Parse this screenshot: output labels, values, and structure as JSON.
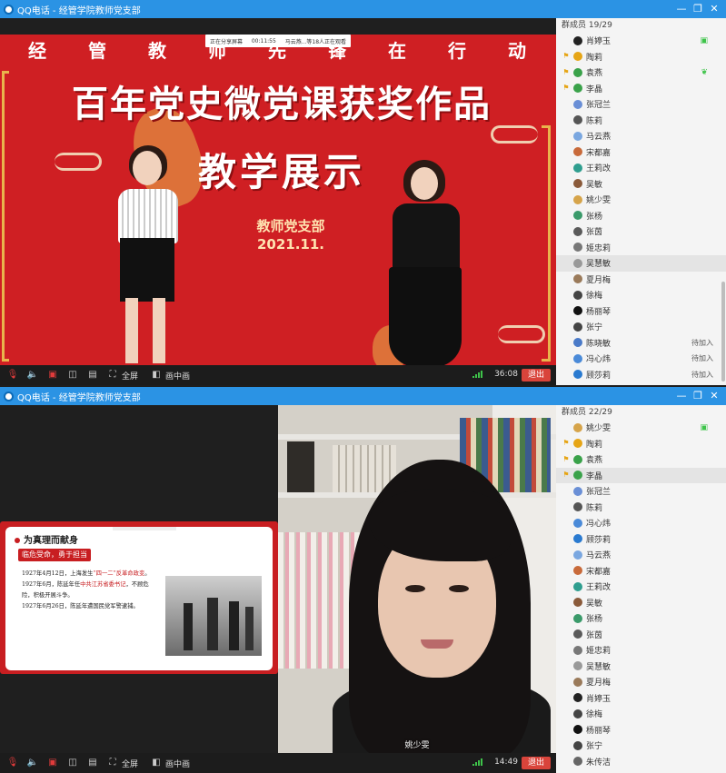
{
  "windows": [
    {
      "title": "QQ电话 - 经管学院教师党支部",
      "share_bar": {
        "sharing": "正在分享屏幕",
        "duration": "00:11:55",
        "watching": "马云燕...等18人正在观看"
      },
      "slide": {
        "top_words": [
          "经",
          "管",
          "教",
          "师",
          "先",
          "锋",
          "在",
          "行",
          "动"
        ],
        "title": "百年党史微党课获奖作品",
        "subtitle": "教学展示",
        "dept": "教师党支部",
        "date": "2021.11."
      },
      "toolbar": {
        "fullscreen": "全屏",
        "pip": "画中画",
        "timer": "36:08",
        "exit": "退出"
      },
      "member_header": "群成员 19/29",
      "members": [
        {
          "name": "肖婷玉",
          "badge": "",
          "color": "#222",
          "status": "",
          "right_icon": "screen"
        },
        {
          "name": "陶莉",
          "badge": "admin",
          "color": "#e6a516",
          "status": "",
          "right_icon": ""
        },
        {
          "name": "袁燕",
          "badge": "admin",
          "color": "#3aa24a",
          "status": "",
          "right_icon": "sound"
        },
        {
          "name": "李晶",
          "badge": "admin",
          "color": "#3aa24a",
          "status": "",
          "right_icon": ""
        },
        {
          "name": "张冠兰",
          "badge": "",
          "color": "#6a8fd6",
          "status": "",
          "right_icon": ""
        },
        {
          "name": "陈莉",
          "badge": "",
          "color": "#555",
          "status": "",
          "right_icon": ""
        },
        {
          "name": "马云燕",
          "badge": "",
          "color": "#7aa7e0",
          "status": "",
          "right_icon": ""
        },
        {
          "name": "宋都嘉",
          "badge": "",
          "color": "#c86a3a",
          "status": "",
          "right_icon": ""
        },
        {
          "name": "王莉改",
          "badge": "",
          "color": "#2f9e8f",
          "status": "",
          "right_icon": ""
        },
        {
          "name": "吴敏",
          "badge": "",
          "color": "#8a5a3a",
          "status": "",
          "right_icon": ""
        },
        {
          "name": "姚少雯",
          "badge": "",
          "color": "#d6a44a",
          "status": "",
          "right_icon": ""
        },
        {
          "name": "张杨",
          "badge": "",
          "color": "#3a9a6a",
          "status": "",
          "right_icon": ""
        },
        {
          "name": "张茵",
          "badge": "",
          "color": "#5a5a5a",
          "status": "",
          "right_icon": ""
        },
        {
          "name": "姬忠莉",
          "badge": "",
          "color": "#777",
          "status": "",
          "right_icon": ""
        },
        {
          "name": "吴慧敏",
          "badge": "",
          "color": "#999",
          "status": "",
          "right_icon": "",
          "selected": true
        },
        {
          "name": "夏月梅",
          "badge": "",
          "color": "#9a7a5a",
          "status": "",
          "right_icon": ""
        },
        {
          "name": "徐梅",
          "badge": "",
          "color": "#444",
          "status": "",
          "right_icon": ""
        },
        {
          "name": "杨丽琴",
          "badge": "",
          "color": "#111",
          "status": "",
          "right_icon": ""
        },
        {
          "name": "张宁",
          "badge": "",
          "color": "#444",
          "status": "",
          "right_icon": ""
        },
        {
          "name": "陈晓敏",
          "badge": "",
          "color": "#4a7ac8",
          "status": "待加入",
          "right_icon": ""
        },
        {
          "name": "冯心炜",
          "badge": "",
          "color": "#4a8ad8",
          "status": "待加入",
          "right_icon": ""
        },
        {
          "name": "顾莎莉",
          "badge": "",
          "color": "#2a7ad0",
          "status": "待加入",
          "right_icon": ""
        }
      ]
    },
    {
      "title": "QQ电话 - 经管学院教师党支部",
      "slide": {
        "heading": "为真理而献身",
        "tag": "临危受命，勇于担当",
        "lines": [
          {
            "pre": "1927年4月12日，上海发生",
            "hl": "“四一二”反革命政变",
            "post": "。"
          },
          {
            "pre": "1927年6月，陈延年任",
            "hl": "中共江苏省委书记",
            "post": "，不顾危"
          },
          {
            "pre": "险，积极开展斗争。",
            "hl": "",
            "post": ""
          },
          {
            "pre": "1927年6月26日，陈延年遭国民党军警逮捕。",
            "hl": "",
            "post": ""
          }
        ]
      },
      "camera_name": "姚少雯",
      "toolbar": {
        "fullscreen": "全屏",
        "pip": "画中画",
        "timer": "14:49",
        "exit": "退出"
      },
      "member_header": "群成员 22/29",
      "members": [
        {
          "name": "姚少雯",
          "badge": "",
          "color": "#d6a44a",
          "status": "",
          "right_icon": "screen"
        },
        {
          "name": "陶莉",
          "badge": "admin",
          "color": "#e6a516",
          "status": "",
          "right_icon": ""
        },
        {
          "name": "袁燕",
          "badge": "admin",
          "color": "#3aa24a",
          "status": "",
          "right_icon": ""
        },
        {
          "name": "李晶",
          "badge": "admin",
          "color": "#3aa24a",
          "status": "",
          "right_icon": "",
          "selected": true
        },
        {
          "name": "张冠兰",
          "badge": "",
          "color": "#6a8fd6",
          "status": "",
          "right_icon": ""
        },
        {
          "name": "陈莉",
          "badge": "",
          "color": "#555",
          "status": "",
          "right_icon": ""
        },
        {
          "name": "冯心炜",
          "badge": "",
          "color": "#4a8ad8",
          "status": "",
          "right_icon": ""
        },
        {
          "name": "顾莎莉",
          "badge": "",
          "color": "#2a7ad0",
          "status": "",
          "right_icon": ""
        },
        {
          "name": "马云燕",
          "badge": "",
          "color": "#7aa7e0",
          "status": "",
          "right_icon": ""
        },
        {
          "name": "宋都嘉",
          "badge": "",
          "color": "#c86a3a",
          "status": "",
          "right_icon": ""
        },
        {
          "name": "王莉改",
          "badge": "",
          "color": "#2f9e8f",
          "status": "",
          "right_icon": ""
        },
        {
          "name": "吴敏",
          "badge": "",
          "color": "#8a5a3a",
          "status": "",
          "right_icon": ""
        },
        {
          "name": "张杨",
          "badge": "",
          "color": "#3a9a6a",
          "status": "",
          "right_icon": ""
        },
        {
          "name": "张茵",
          "badge": "",
          "color": "#5a5a5a",
          "status": "",
          "right_icon": ""
        },
        {
          "name": "姬忠莉",
          "badge": "",
          "color": "#777",
          "status": "",
          "right_icon": ""
        },
        {
          "name": "吴慧敏",
          "badge": "",
          "color": "#999",
          "status": "",
          "right_icon": ""
        },
        {
          "name": "夏月梅",
          "badge": "",
          "color": "#9a7a5a",
          "status": "",
          "right_icon": ""
        },
        {
          "name": "肖婷玉",
          "badge": "",
          "color": "#222",
          "status": "",
          "right_icon": ""
        },
        {
          "name": "徐梅",
          "badge": "",
          "color": "#444",
          "status": "",
          "right_icon": ""
        },
        {
          "name": "杨丽琴",
          "badge": "",
          "color": "#111",
          "status": "",
          "right_icon": ""
        },
        {
          "name": "张宁",
          "badge": "",
          "color": "#444",
          "status": "",
          "right_icon": ""
        },
        {
          "name": "朱传洁",
          "badge": "",
          "color": "#666",
          "status": "",
          "right_icon": ""
        }
      ]
    }
  ],
  "colors": {
    "titlebar": "#2b93e4",
    "slide_red": "#cf1f23",
    "exit": "#d9443b",
    "signal": "#3ec44a"
  }
}
